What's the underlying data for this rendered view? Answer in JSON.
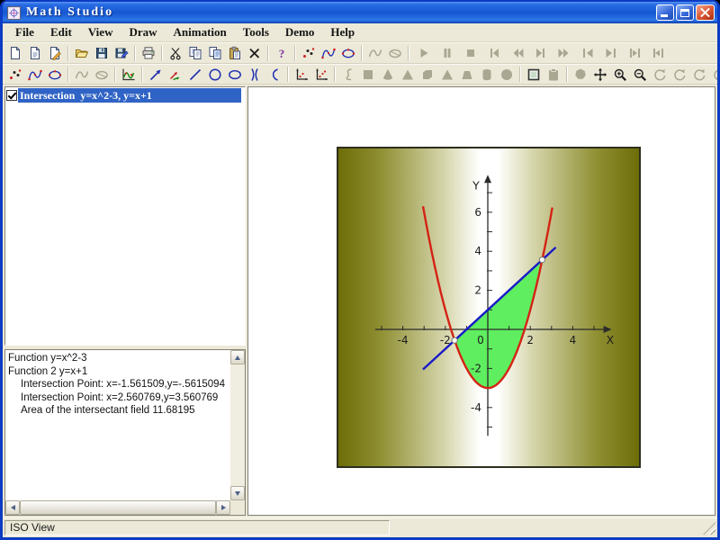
{
  "window": {
    "title": "Math Studio"
  },
  "titlebar": {
    "buttons": [
      {
        "name": "minimize"
      },
      {
        "name": "maximize"
      },
      {
        "name": "close"
      }
    ]
  },
  "menu": {
    "items": [
      "File",
      "Edit",
      "View",
      "Draw",
      "Animation",
      "Tools",
      "Demo",
      "Help"
    ]
  },
  "toolbar_row1": [
    {
      "name": "new",
      "icon": "page",
      "enabled": true
    },
    {
      "name": "new-report",
      "icon": "page-lines",
      "enabled": true
    },
    {
      "name": "edit-document",
      "icon": "page-pencil",
      "enabled": true
    },
    {
      "sep": true
    },
    {
      "name": "open",
      "icon": "folder-open",
      "enabled": true
    },
    {
      "name": "save",
      "icon": "floppy",
      "enabled": true
    },
    {
      "name": "save-as",
      "icon": "floppy-pencil",
      "enabled": true
    },
    {
      "sep": true
    },
    {
      "name": "print",
      "icon": "printer",
      "enabled": true
    },
    {
      "sep": true
    },
    {
      "name": "cut",
      "icon": "scissors",
      "enabled": true
    },
    {
      "name": "copy",
      "icon": "copy",
      "enabled": true
    },
    {
      "name": "copy-special",
      "icon": "copy-plus",
      "enabled": true
    },
    {
      "name": "paste",
      "icon": "clipboard-paste",
      "enabled": true
    },
    {
      "name": "delete",
      "icon": "cross",
      "enabled": true
    },
    {
      "sep": true
    },
    {
      "name": "help",
      "icon": "question",
      "enabled": true
    },
    {
      "sep": true
    },
    {
      "name": "point-set",
      "icon": "dots",
      "enabled": true
    },
    {
      "name": "open-curve",
      "icon": "curve-open",
      "enabled": true
    },
    {
      "name": "closed-curve",
      "icon": "curve-closed",
      "enabled": true
    },
    {
      "sep": true
    },
    {
      "name": "fit-curve",
      "icon": "sketch-open",
      "enabled": false
    },
    {
      "name": "fit-closed-curve",
      "icon": "sketch-closed",
      "enabled": false
    },
    {
      "sep": true
    },
    {
      "name": "anim-play",
      "icon": "play",
      "enabled": false,
      "wide": true
    },
    {
      "name": "anim-pause",
      "icon": "pause",
      "enabled": false,
      "wide": true
    },
    {
      "name": "anim-stop",
      "icon": "stop",
      "enabled": false,
      "wide": true
    },
    {
      "name": "anim-step-back",
      "icon": "step-back",
      "enabled": false,
      "wide": true
    },
    {
      "name": "anim-back",
      "icon": "seek-back",
      "enabled": false,
      "wide": true
    },
    {
      "name": "anim-step-forward",
      "icon": "step-fwd",
      "enabled": false,
      "wide": true
    },
    {
      "name": "anim-forward",
      "icon": "seek-fwd",
      "enabled": false,
      "wide": true
    },
    {
      "name": "anim-go-start",
      "icon": "go-start",
      "enabled": false,
      "wide": true
    },
    {
      "name": "anim-go-end",
      "icon": "go-end",
      "enabled": false,
      "wide": true
    },
    {
      "name": "anim-range-start",
      "icon": "range-start",
      "enabled": false,
      "wide": true
    },
    {
      "name": "anim-range-end",
      "icon": "range-end",
      "enabled": false,
      "wide": true
    }
  ],
  "toolbar_row2": [
    {
      "name": "draw-point-set",
      "icon": "dots",
      "enabled": true
    },
    {
      "name": "draw-open-curve",
      "icon": "curve-open",
      "enabled": true
    },
    {
      "name": "draw-closed-curve",
      "icon": "curve-closed",
      "enabled": true
    },
    {
      "sep": true
    },
    {
      "name": "freehand-curve",
      "icon": "sketch-open",
      "enabled": false
    },
    {
      "name": "freehand-closed",
      "icon": "sketch-closed",
      "enabled": false
    },
    {
      "sep": true
    },
    {
      "name": "plot-function",
      "icon": "function-plot",
      "enabled": true
    },
    {
      "sep": true
    },
    {
      "name": "draw-arrow",
      "icon": "arrow",
      "enabled": true
    },
    {
      "name": "draw-vector",
      "icon": "vector",
      "enabled": true
    },
    {
      "name": "draw-line",
      "icon": "segment",
      "enabled": true
    },
    {
      "name": "draw-circle",
      "icon": "circle",
      "enabled": true
    },
    {
      "name": "draw-ellipse",
      "icon": "ellipse",
      "enabled": true
    },
    {
      "name": "draw-hyperbola",
      "icon": "hyperbola",
      "enabled": true
    },
    {
      "name": "draw-arc",
      "icon": "arc",
      "enabled": true
    },
    {
      "sep": true
    },
    {
      "name": "coordinate-axes",
      "icon": "axes",
      "enabled": true
    },
    {
      "name": "coordinate-axes-grid",
      "icon": "axes-dots",
      "enabled": true
    },
    {
      "sep": true
    },
    {
      "name": "surface",
      "icon": "spline",
      "enabled": false
    },
    {
      "name": "solid-cube",
      "icon": "solid-square",
      "enabled": false
    },
    {
      "name": "solid-cone",
      "icon": "solid-cone",
      "enabled": false
    },
    {
      "name": "solid-pyramid",
      "icon": "solid-triangle",
      "enabled": false
    },
    {
      "name": "solid-box",
      "icon": "solid-box",
      "enabled": false
    },
    {
      "name": "solid-prism",
      "icon": "solid-triangle",
      "enabled": false
    },
    {
      "name": "solid-frustum",
      "icon": "solid-trapezoid",
      "enabled": false
    },
    {
      "name": "solid-cylinder",
      "icon": "solid-cylinder",
      "enabled": false
    },
    {
      "name": "solid-sphere",
      "icon": "solid-sphere",
      "enabled": false
    },
    {
      "sep": true
    },
    {
      "name": "fill-region",
      "icon": "fill-rect",
      "enabled": true
    },
    {
      "name": "paste-object",
      "icon": "clipboard-plain",
      "enabled": false
    },
    {
      "sep": true
    },
    {
      "name": "select-polygon",
      "icon": "polygon",
      "enabled": false
    },
    {
      "name": "pan",
      "icon": "move",
      "enabled": true
    },
    {
      "name": "zoom-in",
      "icon": "magnifier-plus",
      "enabled": true
    },
    {
      "name": "zoom-out",
      "icon": "magnifier-minus",
      "enabled": true
    },
    {
      "name": "rotate-x",
      "icon": "rotate",
      "enabled": false
    },
    {
      "name": "rotate-y",
      "icon": "rotate",
      "enabled": false
    },
    {
      "name": "rotate-z",
      "icon": "rotate",
      "enabled": false
    },
    {
      "name": "rotate-free",
      "icon": "rotate",
      "enabled": false
    }
  ],
  "object_list": {
    "items": [
      {
        "checked": true,
        "selected": true,
        "label": "Intersection  y=x^2-3, y=x+1"
      }
    ]
  },
  "output_panel": {
    "lines": [
      {
        "text": "Function y=x^2-3",
        "indent": 0
      },
      {
        "text": "Function 2 y=x+1",
        "indent": 0
      },
      {
        "text": "Intersection Point: x=-1.561509,y=-.5615094",
        "indent": 1
      },
      {
        "text": "Intersection Point: x=2.560769,y=3.560769",
        "indent": 1
      },
      {
        "text": "Area of the intersectant field 11.68195",
        "indent": 1
      }
    ]
  },
  "statusbar": {
    "text": "ISO View"
  },
  "chart_data": {
    "type": "line",
    "title": "Intersection y=x^2-3, y=x+1",
    "functions": [
      {
        "label": "y=x^2-3",
        "kind": "quadratic",
        "a": 1,
        "b": 0,
        "c": -3,
        "color": "#d42314",
        "domain": [
          -3.05,
          3.05
        ]
      },
      {
        "label": "y=x+1",
        "kind": "linear",
        "m": 1,
        "b": 1,
        "color": "#1a1ac8",
        "domain": [
          -3.05,
          3.2
        ]
      }
    ],
    "intersection_points": [
      {
        "x": -1.561509,
        "y": -0.5615094
      },
      {
        "x": 2.560769,
        "y": 3.560769
      }
    ],
    "intersection_area": 11.68195,
    "region": {
      "from_x": -1.561509,
      "to_x": 2.560769,
      "fill": "#5fee5f"
    },
    "axes": {
      "xlabel": "X",
      "ylabel": "Y",
      "x_range": [
        -5.3,
        5.45
      ],
      "y_range": [
        -5.45,
        7.5
      ],
      "x_tick_labels": [
        -4,
        -2,
        0,
        2,
        4
      ],
      "y_tick_labels": [
        -4,
        -2,
        2,
        4,
        6
      ],
      "minor_tick_step": 1,
      "grid": false
    },
    "background": {
      "direction": "horizontal",
      "gradient": [
        "#6d6d08",
        "#ffffff",
        "#6d6d08"
      ]
    },
    "marker": {
      "shape": "circle",
      "fill": "#ffffff",
      "stroke": "#777777"
    }
  }
}
